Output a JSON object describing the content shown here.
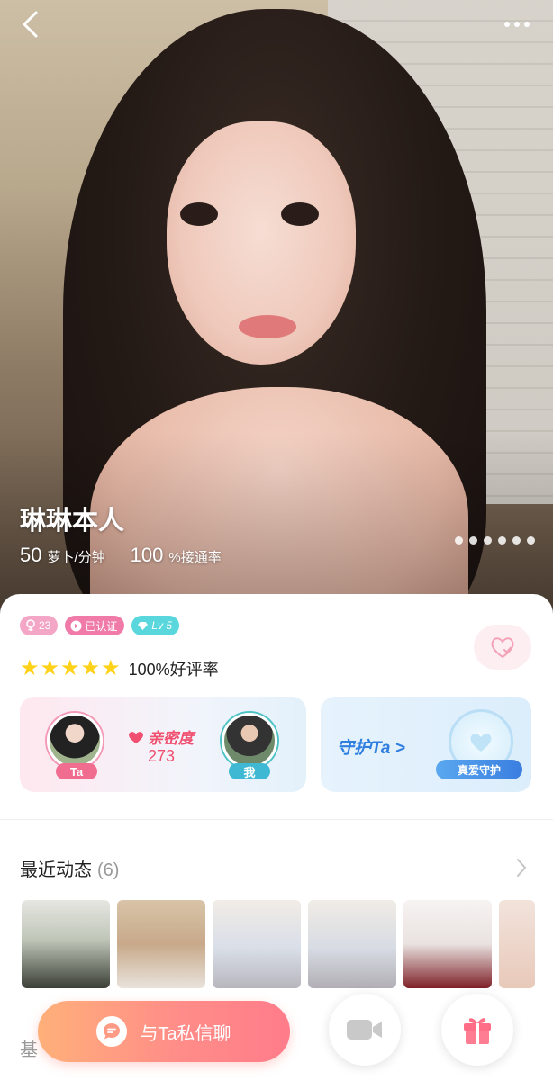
{
  "profile": {
    "name": "琳琳本人",
    "price_value": "50",
    "price_unit": "萝卜/分钟",
    "answer_rate_value": "100",
    "answer_rate_unit": "%接通率",
    "photo_count": 6
  },
  "badges": {
    "age": "23",
    "verified": "已认证",
    "level": "Lv 5"
  },
  "rating": {
    "stars": 5,
    "text": "100%好评率"
  },
  "intimacy": {
    "label": "亲密度",
    "value": "273",
    "ta_tag": "Ta",
    "me_tag": "我"
  },
  "guard": {
    "label": "守护Ta >",
    "banner": "真爱守护"
  },
  "moments": {
    "title": "最近动态",
    "count": "(6)"
  },
  "basic_section_label": "基",
  "actions": {
    "chat": "与Ta私信聊"
  },
  "colors": {
    "accent_pink": "#f04f6f",
    "chat_gradient_start": "#ffb07a",
    "chat_gradient_end": "#ff7c8a",
    "star": "#ffd21a",
    "guard_blue": "#2f7fe0"
  },
  "icons": [
    "back-icon",
    "more-icon",
    "age-icon",
    "verified-icon",
    "diamond-icon",
    "star-icon",
    "heart-outline-icon",
    "heart-icon",
    "chevron-right-icon",
    "chat-bubble-icon",
    "video-camera-icon",
    "gift-icon"
  ]
}
